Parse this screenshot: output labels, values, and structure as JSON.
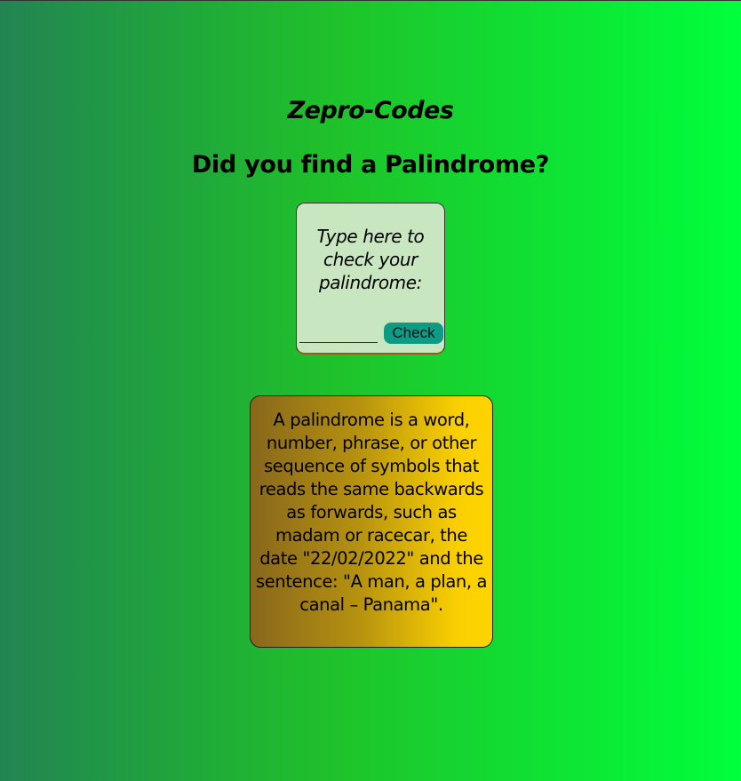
{
  "header": {
    "brand": "Zepro-Codes",
    "title": "Did you find a Palindrome?"
  },
  "checker": {
    "prompt": "Type here to check your palindrome:",
    "input_value": "",
    "input_placeholder": "",
    "button_label": "Check"
  },
  "definition": {
    "text": "A palindrome is a word, number, phrase, or other sequence of symbols that reads the same backwards as forwards, such as madam or racecar, the date \"22/02/2022\" and the sentence: \"A man, a plan, a canal – Panama\"."
  },
  "colors": {
    "background_left": "#228452",
    "background_right": "#00ff3c",
    "card_background": "#c8e7c0",
    "button_background": "#0f9a86",
    "definition_left": "#88671c",
    "definition_right": "#ffd400"
  }
}
